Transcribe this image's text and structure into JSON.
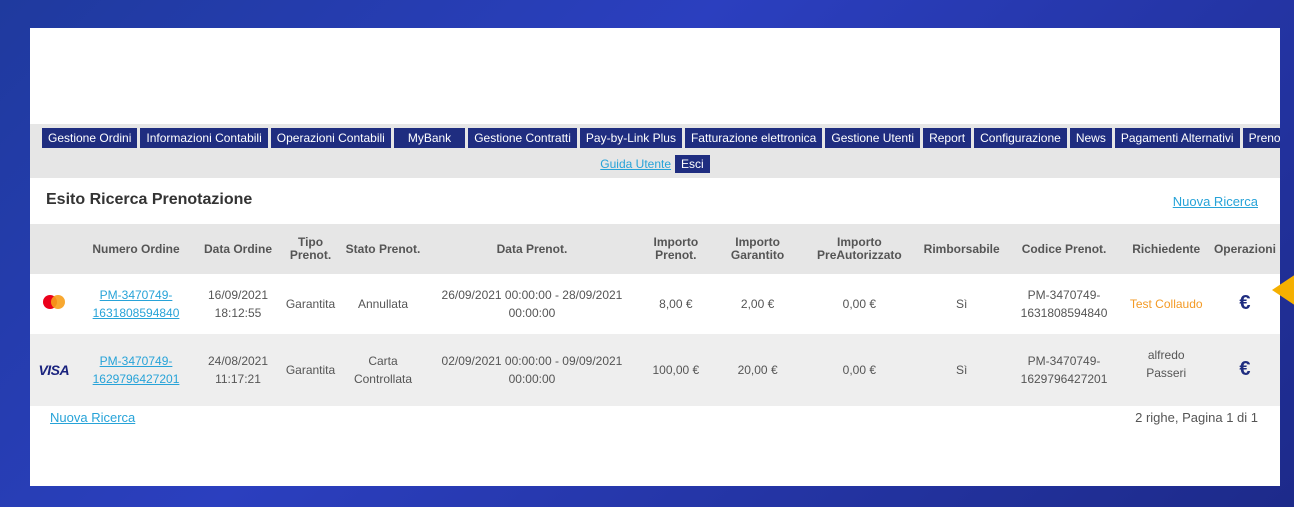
{
  "nav": {
    "items": [
      "Gestione Ordini",
      "Informazioni Contabili",
      "Operazioni Contabili",
      "MyBank",
      "Gestione Contratti",
      "Pay-by-Link Plus",
      "Fatturazione elettronica",
      "Gestione Utenti",
      "Report",
      "Configurazione",
      "News",
      "Pagamenti Alternativi",
      "Prenotazioni"
    ],
    "guide_label": "Guida Utente",
    "exit_label": "Esci"
  },
  "page": {
    "title": "Esito Ricerca Prenotazione",
    "new_search_label": "Nuova Ricerca",
    "pager": "2 righe, Pagina 1 di 1"
  },
  "table": {
    "headers": [
      "",
      "Numero Ordine",
      "Data Ordine",
      "Tipo Prenot.",
      "Stato Prenot.",
      "Data Prenot.",
      "Importo Prenot.",
      "Importo Garantito",
      "Importo PreAutorizzato",
      "Rimborsabile",
      "Codice Prenot.",
      "Richiedente",
      "Operazioni"
    ],
    "rows": [
      {
        "card": "mastercard",
        "order_line1": "PM-3470749-",
        "order_line2": "1631808594840",
        "date_line1": "16/09/2021",
        "date_line2": "18:12:55",
        "type": "Garantita",
        "status_line1": "Annullata",
        "status_line2": "",
        "res_line1": "26/09/2021 00:00:00 - 28/09/2021",
        "res_line2": "00:00:00",
        "amount": "8,00 €",
        "guaranteed": "2,00 €",
        "preauth": "0,00 €",
        "refundable": "Sì",
        "code_line1": "PM-3470749-",
        "code_line2": "1631808594840",
        "requester": "Test Collaudo",
        "op": "€"
      },
      {
        "card": "VISA",
        "order_line1": "PM-3470749-",
        "order_line2": "1629796427201",
        "date_line1": "24/08/2021",
        "date_line2": "11:17:21",
        "type": "Garantita",
        "status_line1": "Carta",
        "status_line2": "Controllata",
        "res_line1": "02/09/2021 00:00:00 - 09/09/2021",
        "res_line2": "00:00:00",
        "amount": "100,00 €",
        "guaranteed": "20,00 €",
        "preauth": "0,00 €",
        "refundable": "Sì",
        "code_line1": "PM-3470749-",
        "code_line2": "1629796427201",
        "requester": "alfredo Passeri",
        "op": "€"
      }
    ]
  },
  "colors": {
    "nav_bg": "#1f2d80",
    "link": "#27a3d8",
    "accent_orange": "#f39a25",
    "pointer": "#f5b000"
  }
}
